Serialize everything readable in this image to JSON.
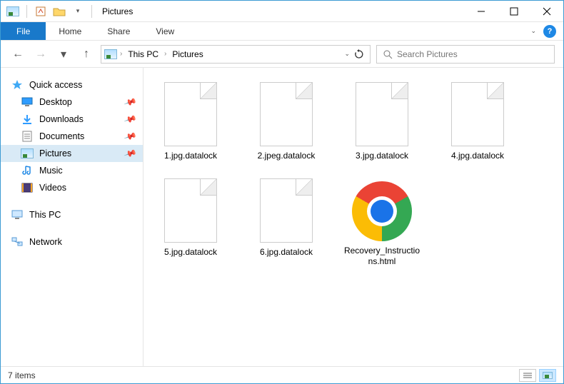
{
  "title": "Pictures",
  "ribbon": {
    "file": "File",
    "home": "Home",
    "share": "Share",
    "view": "View"
  },
  "breadcrumb": {
    "root": "This PC",
    "current": "Pictures"
  },
  "search": {
    "placeholder": "Search Pictures"
  },
  "sidebar": {
    "quick_access": "Quick access",
    "items": [
      {
        "label": "Desktop",
        "icon": "desktop-icon",
        "pinned": true
      },
      {
        "label": "Downloads",
        "icon": "downloads-icon",
        "pinned": true
      },
      {
        "label": "Documents",
        "icon": "documents-icon",
        "pinned": true
      },
      {
        "label": "Pictures",
        "icon": "pictures-icon",
        "pinned": true,
        "selected": true
      },
      {
        "label": "Music",
        "icon": "music-icon",
        "pinned": false
      },
      {
        "label": "Videos",
        "icon": "videos-icon",
        "pinned": false
      }
    ],
    "this_pc": "This PC",
    "network": "Network"
  },
  "files": [
    {
      "name": "1.jpg.datalock",
      "type": "generic"
    },
    {
      "name": "2.jpeg.datalock",
      "type": "generic"
    },
    {
      "name": "3.jpg.datalock",
      "type": "generic"
    },
    {
      "name": "4.jpg.datalock",
      "type": "generic"
    },
    {
      "name": "5.jpg.datalock",
      "type": "generic"
    },
    {
      "name": "6.jpg.datalock",
      "type": "generic"
    },
    {
      "name": "Recovery_Instructions.html",
      "type": "chrome"
    }
  ],
  "status": {
    "count_label": "7 items"
  }
}
